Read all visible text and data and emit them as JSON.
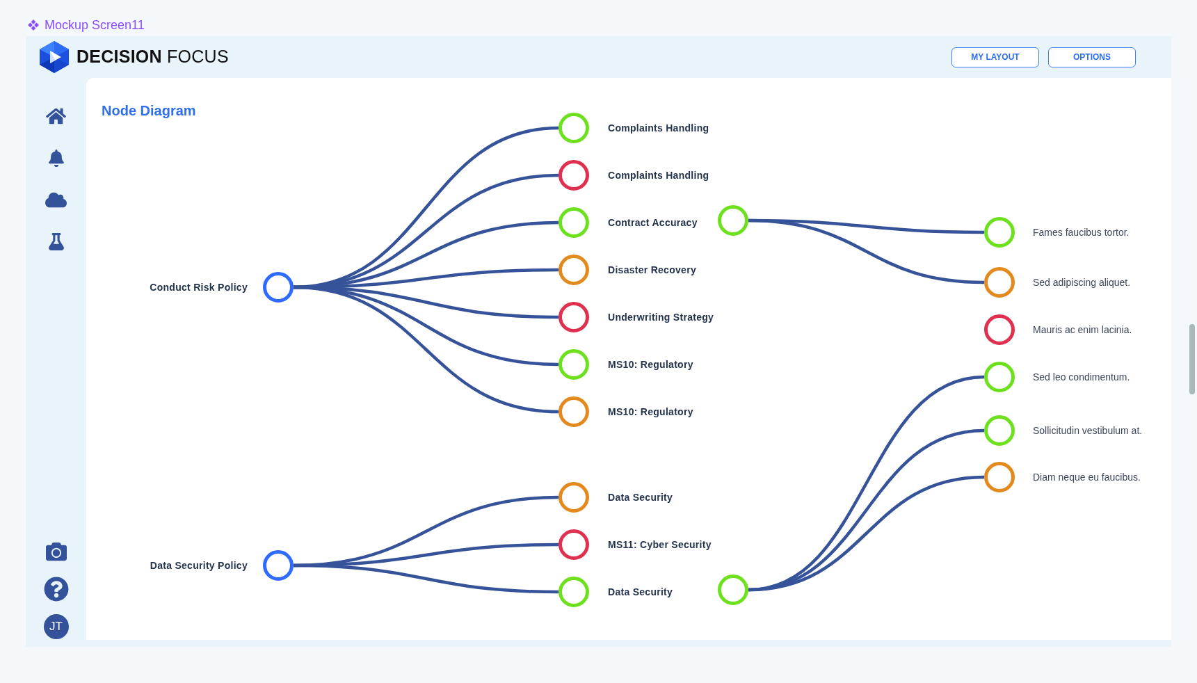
{
  "page_title": "Mockup Screen11",
  "header": {
    "brand": "**DECISION** FOCUS",
    "buttons": [
      "MY LAYOUT",
      "OPTIONS"
    ]
  },
  "sidebar": {
    "avatar": "JT"
  },
  "panel": {
    "title": "Node Diagram",
    "trees": [
      {
        "label": "Conduct Risk Policy",
        "color": "#2f6bff",
        "children": [
          {
            "label": "Complaints Handling",
            "color": "#6ee11f"
          },
          {
            "label": "Complaints Handling",
            "color": "#e0304f"
          },
          {
            "label": "Contract Accuracy",
            "color": "#6ee11f",
            "children": [
              {
                "color": "#6ee11f",
                "children": [
                  {
                    "label": "Fames faucibus tortor.",
                    "color": "#6ee11f"
                  },
                  {
                    "label": "Sed adipiscing aliquet.",
                    "color": "#e38a1f"
                  }
                ]
              }
            ]
          },
          {
            "label": "Disaster Recovery",
            "color": "#e38a1f"
          },
          {
            "label": "Underwriting Strategy",
            "color": "#e0304f"
          },
          {
            "label": "MS10: Regulatory",
            "color": "#6ee11f"
          },
          {
            "label": "MS10: Regulatory",
            "color": "#e38a1f"
          }
        ]
      },
      {
        "label": "Data Security Policy",
        "color": "#2f6bff",
        "children": [
          {
            "label": "Data Security",
            "color": "#e38a1f"
          },
          {
            "label": "MS11: Cyber Security",
            "color": "#e0304f"
          },
          {
            "label": "Data Security",
            "color": "#6ee11f",
            "children": [
              {
                "color": "#6ee11f",
                "children": [
                  {
                    "label": "Sed leo condimentum.",
                    "color": "#6ee11f"
                  },
                  {
                    "label": "Sollicitudin vestibulum at.",
                    "color": "#6ee11f"
                  },
                  {
                    "label": "Diam neque eu faucibus.",
                    "color": "#e38a1f"
                  }
                ]
              }
            ]
          }
        ]
      }
    ],
    "unlinked_nodes": [
      {
        "label": "Mauris ac enim lacinia.",
        "color": "#e0304f"
      }
    ]
  }
}
